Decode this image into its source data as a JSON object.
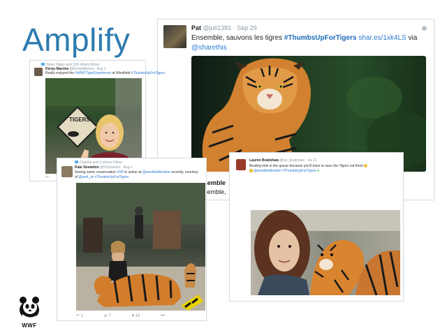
{
  "slide_title": "Amplify",
  "tweet_main": {
    "author": "Pat",
    "handle": "@juti1381",
    "date": "Sep 29",
    "text": "Ensemble, sauvons les tigres ",
    "hashtag": "#ThumbsUpForTigers",
    "link": "shar.es/1xk4LS",
    "via": " via",
    "mention": "@sharethis"
  },
  "tweet_kirsty": {
    "retweet_line": "Helen Biggs and 199 others follow",
    "author": "Kirsty Marrins",
    "handle": "@KirstyMarrins",
    "date": "Aug 1",
    "text_start": "Really enjoyed the ",
    "hashtag1": "#WWFTigerExperience",
    "text_mid": " at Westfield ",
    "hashtag2": "#ThumbsUpForTigers",
    "sign_text": "TIGERS"
  },
  "tweet_kate": {
    "retweet_line": "Chantal and 3 others follow",
    "author": "Kate Snowdon",
    "handle": "@KSnowden",
    "date": "Aug 1",
    "line1_start": "Seeing some conservation ",
    "hashtag_vr": "#VR",
    "line1_mid": " in action at ",
    "mention_westfield": "@westfieldlondon",
    "line1_end": " recently, courtesy",
    "line2_start": "of ",
    "mention_wwf": "@wwf_uk",
    "hashtag": "#ThumbsUpForTigers",
    "reply_count": "1",
    "retweet_count": "7",
    "like_count": "10",
    "more": "•••"
  },
  "tweet_lauren": {
    "author": "Lauren Bradshaw",
    "handle": "@lzz_bradshaw",
    "date": "Jul 21",
    "line1": "Beating kids in the queue because you'll have to save the Tigers not them",
    "mention": "@westfieldlondon",
    "hashtag": "#ThumbsUpForTigers"
  },
  "hidden_fragment": {
    "line1": "semble",
    "line2": "semble,"
  },
  "logo": {
    "text": "WWF"
  },
  "colors": {
    "title": "#2e7bb0",
    "link": "#2a7ad0",
    "hashtag": "#1b6ab8",
    "muted": "#8899a6"
  }
}
